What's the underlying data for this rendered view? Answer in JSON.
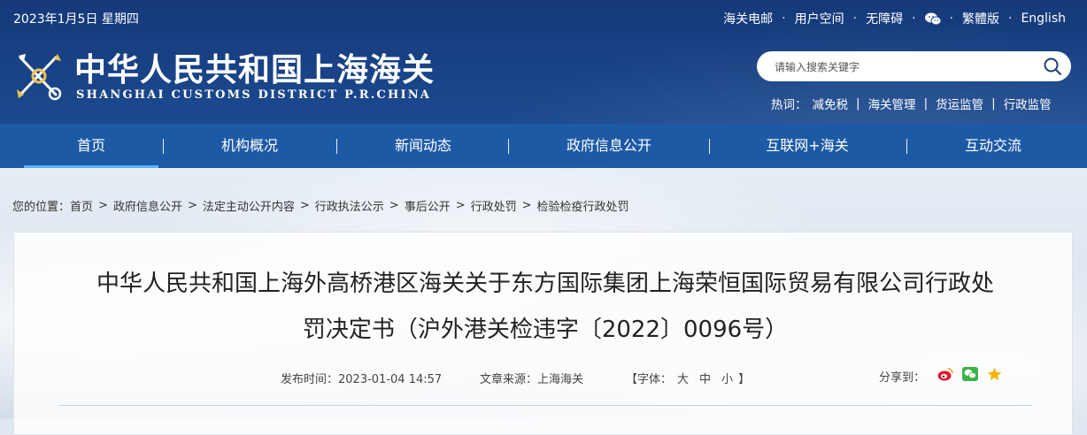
{
  "header": {
    "date": "2023年1月5日 星期四",
    "top_links": [
      "海关电邮",
      "用户空间",
      "无障碍",
      "繁體版",
      "English"
    ],
    "title": "中华人民共和国上海海关",
    "subtitle": "SHANGHAI CUSTOMS DISTRICT P.R.CHINA"
  },
  "search": {
    "placeholder": "请输入搜索关键字"
  },
  "hotwords": {
    "label": "热词：",
    "items": [
      "减免税",
      "海关管理",
      "货运监管",
      "行政监管"
    ]
  },
  "nav": {
    "items": [
      "首页",
      "机构概况",
      "新闻动态",
      "政府信息公开",
      "互联网+海关",
      "互动交流"
    ],
    "active": "首页"
  },
  "breadcrumb": {
    "label": "您的位置：",
    "items": [
      "首页",
      "政府信息公开",
      "法定主动公开内容",
      "行政执法公示",
      "事后公开",
      "行政处罚",
      "检验检疫行政处罚"
    ]
  },
  "article": {
    "title_line1": "中华人民共和国上海外高桥港区海关关于东方国际集团上海荣恒国际贸易有限公司行政处",
    "title_line2": "罚决定书（沪外港关检违字〔2022〕0096号）",
    "publish_label": "发布时间：",
    "publish_time": "2023-01-04 14:57",
    "source_label": "文章来源：",
    "source": "上海海关",
    "font_label_open": "【字体：",
    "font_large": "大",
    "font_medium": "中",
    "font_small": "小",
    "font_label_close": "】",
    "share_label": "分享到："
  },
  "colors": {
    "header_bg": "#15397a",
    "nav_bg": "#1d5aa6",
    "active_underline": "#5ab3ff",
    "weibo": "#e6162d",
    "wechat": "#3bb34a",
    "qzone": "#f5b400"
  }
}
